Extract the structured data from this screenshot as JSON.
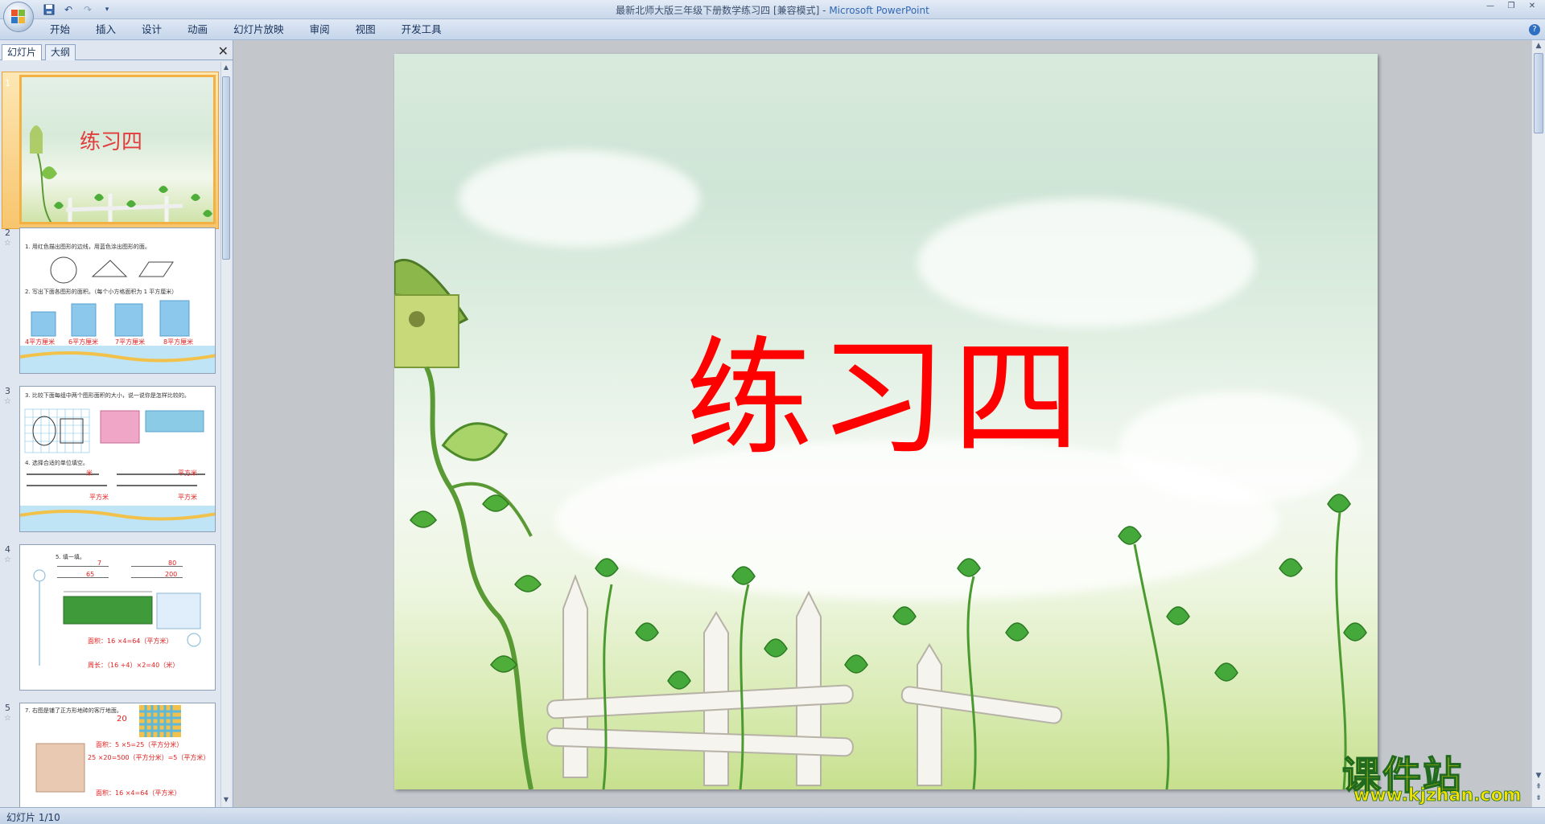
{
  "app": {
    "window_title": "最新北师大版三年级下册数学练习四 [兼容模式]",
    "title_separator": " - ",
    "app_name": "Microsoft PowerPoint"
  },
  "ribbon": {
    "tabs": [
      "开始",
      "插入",
      "设计",
      "动画",
      "幻灯片放映",
      "审阅",
      "视图",
      "开发工具"
    ]
  },
  "left_pane": {
    "tab_slides": "幻灯片",
    "tab_outline": "大纲",
    "slides": [
      {
        "num": "1",
        "title": "练习四"
      },
      {
        "num": "2",
        "heading1": "1. 用红色描出图形的边线，用蓝色涂出图形的面。",
        "heading2": "2. 写出下面各图形的面积。（每个小方格面积为 1 平方厘米）",
        "answers": [
          "4平方厘米",
          "6平方厘米",
          "7平方厘米",
          "8平方厘米"
        ]
      },
      {
        "num": "3",
        "heading1": "3. 比较下面每组中两个图形面积的大小，说一说你是怎样比较的。",
        "heading2": "4. 选择合适的单位填空。",
        "answers": [
          "米",
          "平方米",
          "平方米",
          "平方米"
        ]
      },
      {
        "num": "4",
        "heading1": "5. 填一填。",
        "answers": [
          "7",
          "80",
          "65",
          "200"
        ],
        "line1": "面积：16 ×4=64（平方米）",
        "line2": "周长：（16 +4）×2=40（米）"
      },
      {
        "num": "5",
        "heading1": "7. 右图是铺了正方形地砖的客厅地面。",
        "answers": [
          "20",
          "面积：5 ×5=25（平方分米）",
          "25 ×20=500（平方分米）=5（平方米）",
          "面积：16 ×4=64（平方米）"
        ]
      }
    ]
  },
  "slide": {
    "title": "练习四"
  },
  "status": {
    "slide_indicator": "幻灯片 1/10"
  },
  "watermark": {
    "brand": "课件站",
    "url": "www.kjzhan.com"
  }
}
